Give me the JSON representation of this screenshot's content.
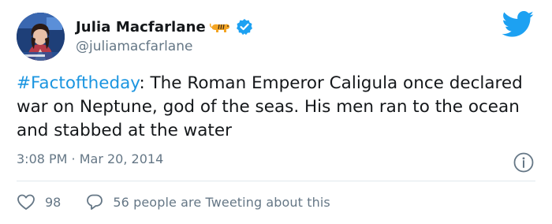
{
  "author": {
    "display_name": "Julia Macfarlane",
    "handle": "@juliamacfarlane"
  },
  "icons": {
    "avatar": "avatar-photo",
    "emoji": "tiger-icon",
    "verified": "verified-badge-icon",
    "logo": "twitter-bird-icon",
    "info": "info-icon",
    "like": "heart-icon",
    "reply": "speech-bubble-icon"
  },
  "tweet": {
    "hashtag": "#Factoftheday",
    "body": ": The Roman Emperor Caligula once declared war on Neptune, god of the seas. His men ran to the ocean and stabbed at the water",
    "timestamp": "3:08 PM · Mar 20, 2014"
  },
  "actions": {
    "like_count": "98",
    "tweeting_text": "56 people are Tweeting about this"
  },
  "colors": {
    "link": "#1b95e0",
    "muted": "#657786",
    "verified": "#1da1f2",
    "divider": "#e1e8ed"
  }
}
